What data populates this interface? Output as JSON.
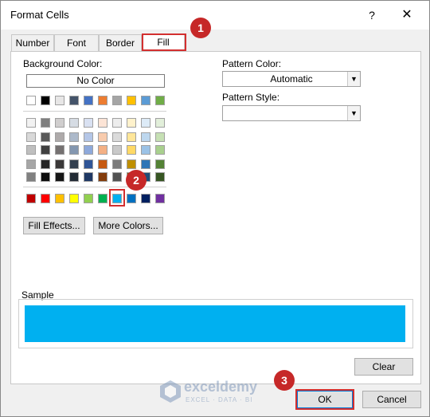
{
  "title": "Format Cells",
  "help_glyph": "?",
  "close_glyph": "✕",
  "tabs": [
    "Number",
    "Font",
    "Border",
    "Fill"
  ],
  "active_tab": "Fill",
  "background_color_label": "Background Color:",
  "no_color_label": "No Color",
  "palette": {
    "theme_row": [
      "#ffffff",
      "#000000",
      "#e7e6e6",
      "#44546a",
      "#4472c4",
      "#ed7d31",
      "#a5a5a5",
      "#ffc000",
      "#5b9bd5",
      "#70ad47"
    ],
    "shades": [
      [
        "#f2f2f2",
        "#7f7f7f",
        "#d0cece",
        "#d6dce4",
        "#d9e1f2",
        "#fce4d6",
        "#ededed",
        "#fff2cc",
        "#ddebf7",
        "#e2efda"
      ],
      [
        "#d9d9d9",
        "#595959",
        "#aeaaaa",
        "#acb9ca",
        "#b4c6e7",
        "#f8cbad",
        "#dbdbdb",
        "#ffe699",
        "#bdd7ee",
        "#c6e0b4"
      ],
      [
        "#bfbfbf",
        "#404040",
        "#757171",
        "#8497b0",
        "#8ea9db",
        "#f4b084",
        "#c9c9c9",
        "#ffd966",
        "#9bc2e6",
        "#a9d08e"
      ],
      [
        "#a6a6a6",
        "#262626",
        "#3a3838",
        "#333f4f",
        "#2f5597",
        "#c65911",
        "#7b7b7b",
        "#bf8f00",
        "#2e75b6",
        "#548235"
      ],
      [
        "#808080",
        "#0d0d0d",
        "#161616",
        "#222b35",
        "#1f3864",
        "#833c0b",
        "#525252",
        "#7f6000",
        "#1f4e78",
        "#375623"
      ]
    ],
    "standard_row": [
      "#c00000",
      "#ff0000",
      "#ffc000",
      "#ffff00",
      "#92d050",
      "#00b050",
      "#00b0f0",
      "#0070c0",
      "#002060",
      "#7030a0"
    ]
  },
  "selected_color": "#00b0f0",
  "fill_effects_label": "Fill Effects...",
  "more_colors_label": "More Colors...",
  "pattern_color_label": "Pattern Color:",
  "pattern_color_value": "Automatic",
  "pattern_style_label": "Pattern Style:",
  "pattern_style_value": "",
  "sample_label": "Sample",
  "clear_label": "Clear",
  "ok_label": "OK",
  "cancel_label": "Cancel",
  "annotations": [
    "1",
    "2",
    "3"
  ],
  "watermark": {
    "name": "exceldemy",
    "tagline": "EXCEL · DATA · BI"
  }
}
